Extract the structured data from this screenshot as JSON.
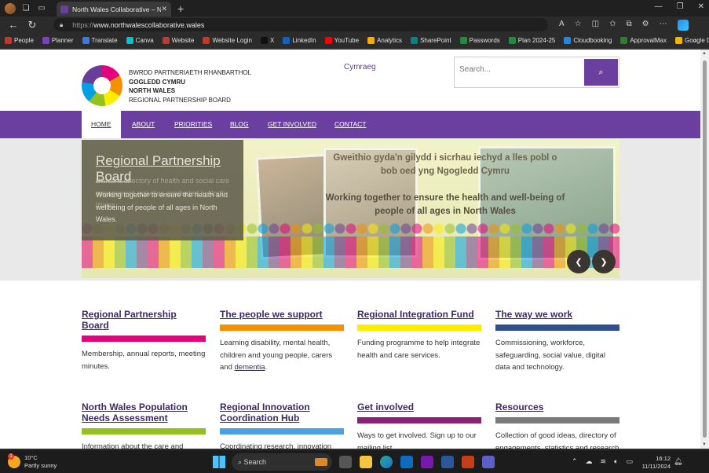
{
  "browser": {
    "tab_title": "North Wales Collaborative – Nort",
    "tab_close": "✕",
    "new_tab": "+",
    "url_prefix": "https://",
    "url_domain": "www.northwalescollaborative.wales",
    "window_controls": [
      "—",
      "❐",
      "✕"
    ]
  },
  "bookmarks": [
    {
      "label": "People",
      "color": "#c0392b"
    },
    {
      "label": "Planner",
      "color": "#7b3fc4"
    },
    {
      "label": "Translate",
      "color": "#3b78e7"
    },
    {
      "label": "Canva",
      "color": "#00c4cc"
    },
    {
      "label": "Website",
      "color": "#c0392b"
    },
    {
      "label": "Website Login",
      "color": "#c0392b"
    },
    {
      "label": "X",
      "color": "#111111"
    },
    {
      "label": "LinkedIn",
      "color": "#0a66c2"
    },
    {
      "label": "YouTube",
      "color": "#ff0000"
    },
    {
      "label": "Analytics",
      "color": "#f9ab00"
    },
    {
      "label": "SharePoint",
      "color": "#038387"
    },
    {
      "label": "Passwords",
      "color": "#1e8e3e"
    },
    {
      "label": "Plan 2024-25",
      "color": "#1e8e3e"
    },
    {
      "label": "Cloudbooking",
      "color": "#1e88e5"
    },
    {
      "label": "ApprovalMax",
      "color": "#2e7d32"
    },
    {
      "label": "Google Drive",
      "color": "#f4b400"
    }
  ],
  "header": {
    "org_line1": "BWRDD PARTNERIAETH RHANBARTHOL",
    "org_line2": "GOGLEDD CYMRU",
    "org_line3": "NORTH WALES",
    "org_line4": "REGIONAL PARTNERSHIP BOARD",
    "language_link": "Cymraeg",
    "search_placeholder": "Search..."
  },
  "nav": [
    {
      "label": "HOME",
      "active": true
    },
    {
      "label": "ABOUT"
    },
    {
      "label": "PRIORITIES"
    },
    {
      "label": "BLOG"
    },
    {
      "label": "GET INVOLVED"
    },
    {
      "label": "CONTACT"
    }
  ],
  "hero": {
    "title": "Regional Partnership Board",
    "description": "Working together to ensure the health and wellbeing of people of all ages in North Wales.",
    "ghost_text": "Bwrdd a directory of health and social care engagement activities conducted in North Wales",
    "banner_welsh": "Gweithio gyda'n gilydd i sicrhau iechyd a lles pobl o bob oed yng Ngogledd Cymru",
    "banner_english": "Working together to ensure the health and well-being of people of all ages in North Wales",
    "prev": "❮",
    "next": "❯"
  },
  "cards": [
    {
      "title": "Regional Partnership Board",
      "color": "#e6007e",
      "desc": "Membership, annual reports, meeting minutes."
    },
    {
      "title": "The people we support",
      "color": "#f39200",
      "desc": "Learning disability, mental health, children and young people, carers and ",
      "link": "dementia",
      "after": "."
    },
    {
      "title": "Regional Integration Fund",
      "color": "#ffed00",
      "desc": "Funding programme to help integrate health and care services."
    },
    {
      "title": "The way we work",
      "color": "#2f4f8f",
      "desc": "Commissioning, workforce, safeguarding, social value, digital data and technology."
    },
    {
      "title": "North Wales Population Needs Assessment",
      "color": "#95c11f",
      "desc": "Information about the care and"
    },
    {
      "title": "Regional Innovation Coordination Hub",
      "color": "#4aa3df",
      "desc": "Coordinating research, innovation"
    },
    {
      "title": "Get involved",
      "color": "#8b1f7a",
      "desc": "Ways to get involved. Sign up to our mailing list"
    },
    {
      "title": "Resources",
      "color": "#7a7a7a",
      "desc": "Collection of good ideas, directory of engagements, statistics and research"
    }
  ],
  "taskbar": {
    "temperature": "10°C",
    "weather": "Partly sunny",
    "weather_badge": "1",
    "search_label": "Search",
    "time": "16:12",
    "date": "11/11/2024"
  }
}
